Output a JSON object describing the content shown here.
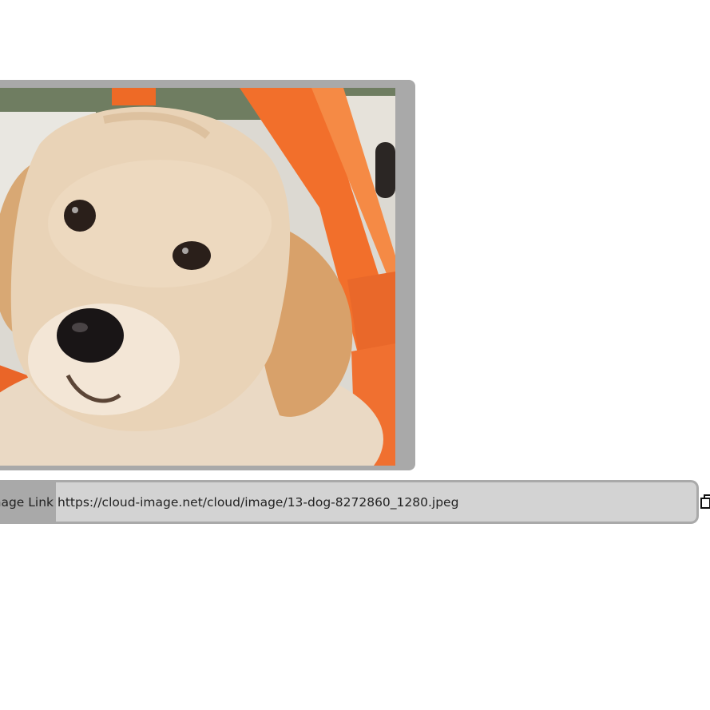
{
  "image": {
    "alt": "golden retriever puppy"
  },
  "link_bar": {
    "label": "Image Link",
    "url": "https://cloud-image.net/cloud/image/13-dog-8272860_1280.jpeg"
  },
  "icons": {
    "copy": "copy-icon"
  }
}
